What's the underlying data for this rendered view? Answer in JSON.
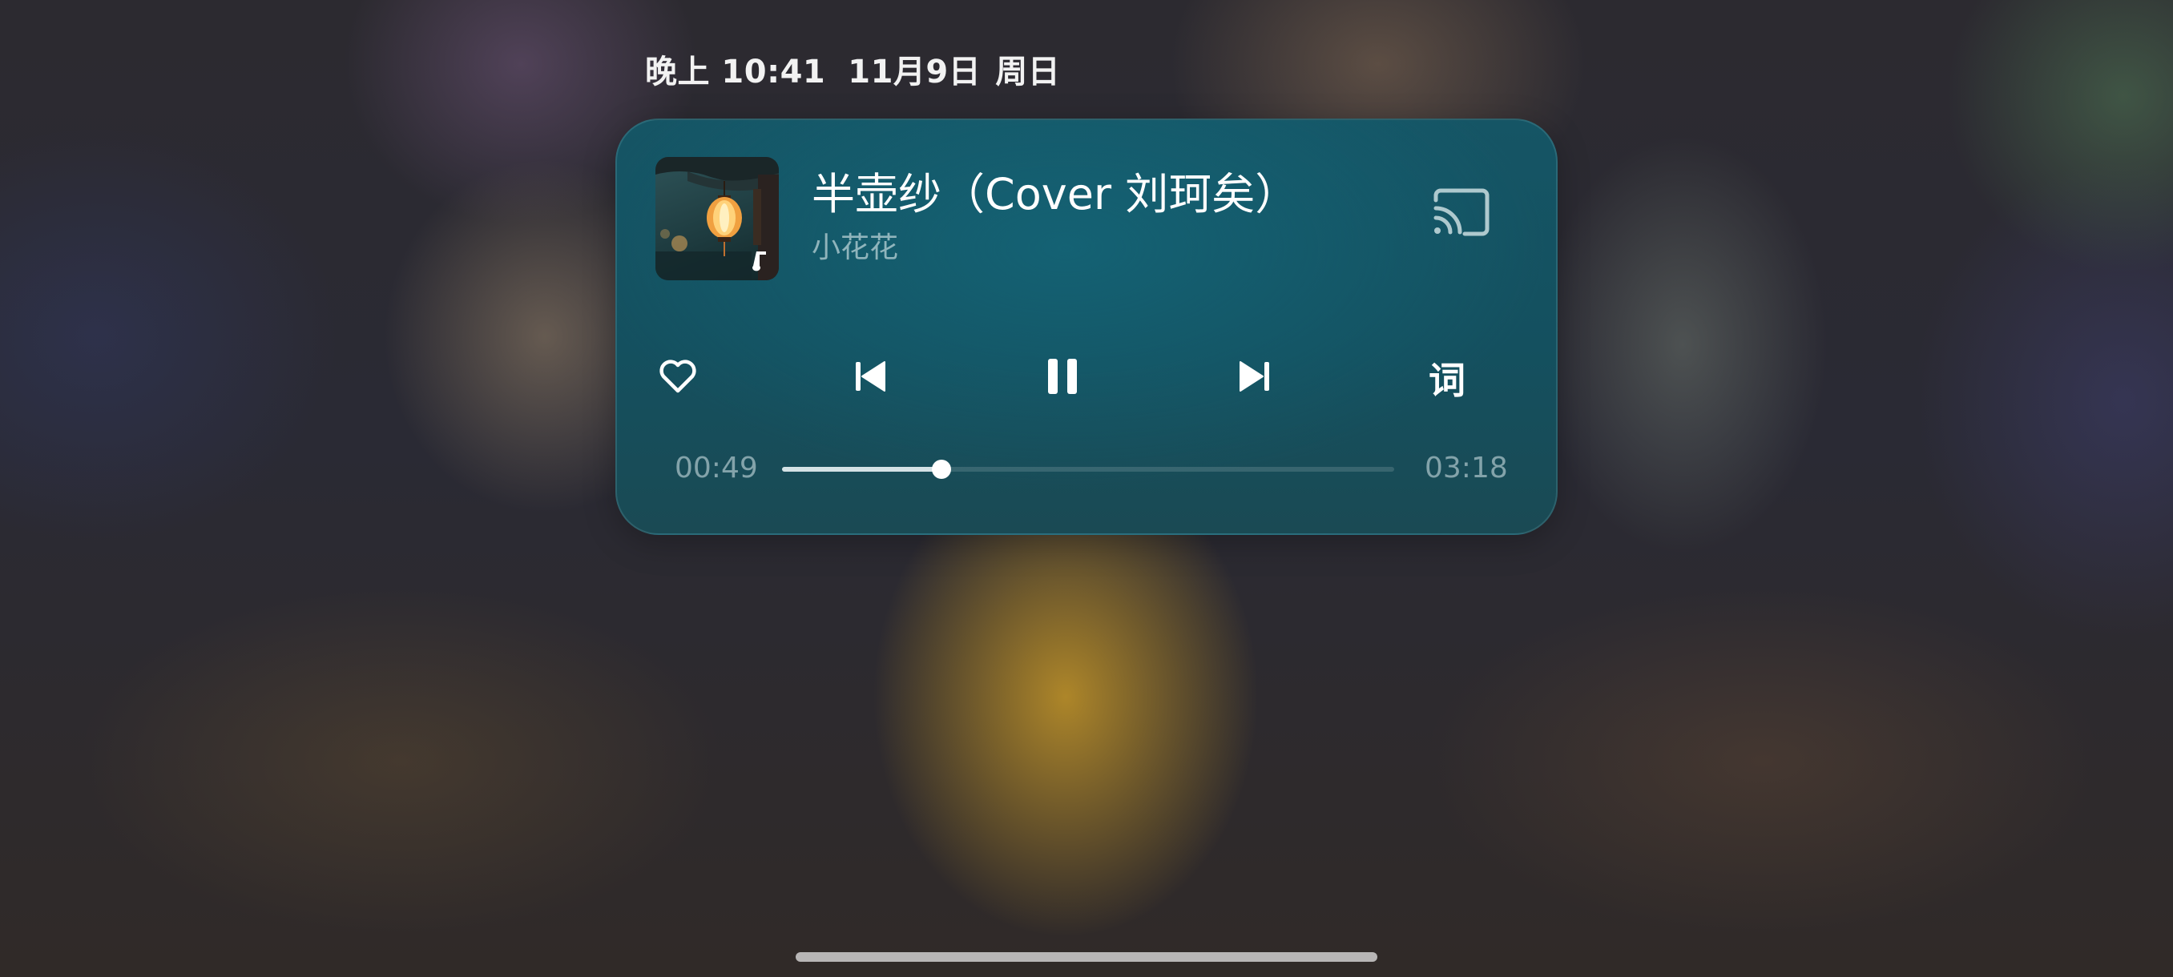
{
  "status": {
    "time": "晚上 10:41",
    "date": "11月9日",
    "weekday": "周日"
  },
  "player": {
    "title": "半壶纱（Cover 刘珂矣）",
    "artist": "小花花",
    "lyrics_label": "词",
    "elapsed": "00:49",
    "duration": "03:18",
    "progress_fraction": 0.26,
    "is_playing": true,
    "liked": false,
    "accent_color": "#155565"
  },
  "icons": {
    "cover": "album-cover-lantern",
    "cast": "cast-icon",
    "like": "heart-outline-icon",
    "previous": "skip-previous-icon",
    "play_pause": "pause-icon",
    "next": "skip-next-icon"
  }
}
